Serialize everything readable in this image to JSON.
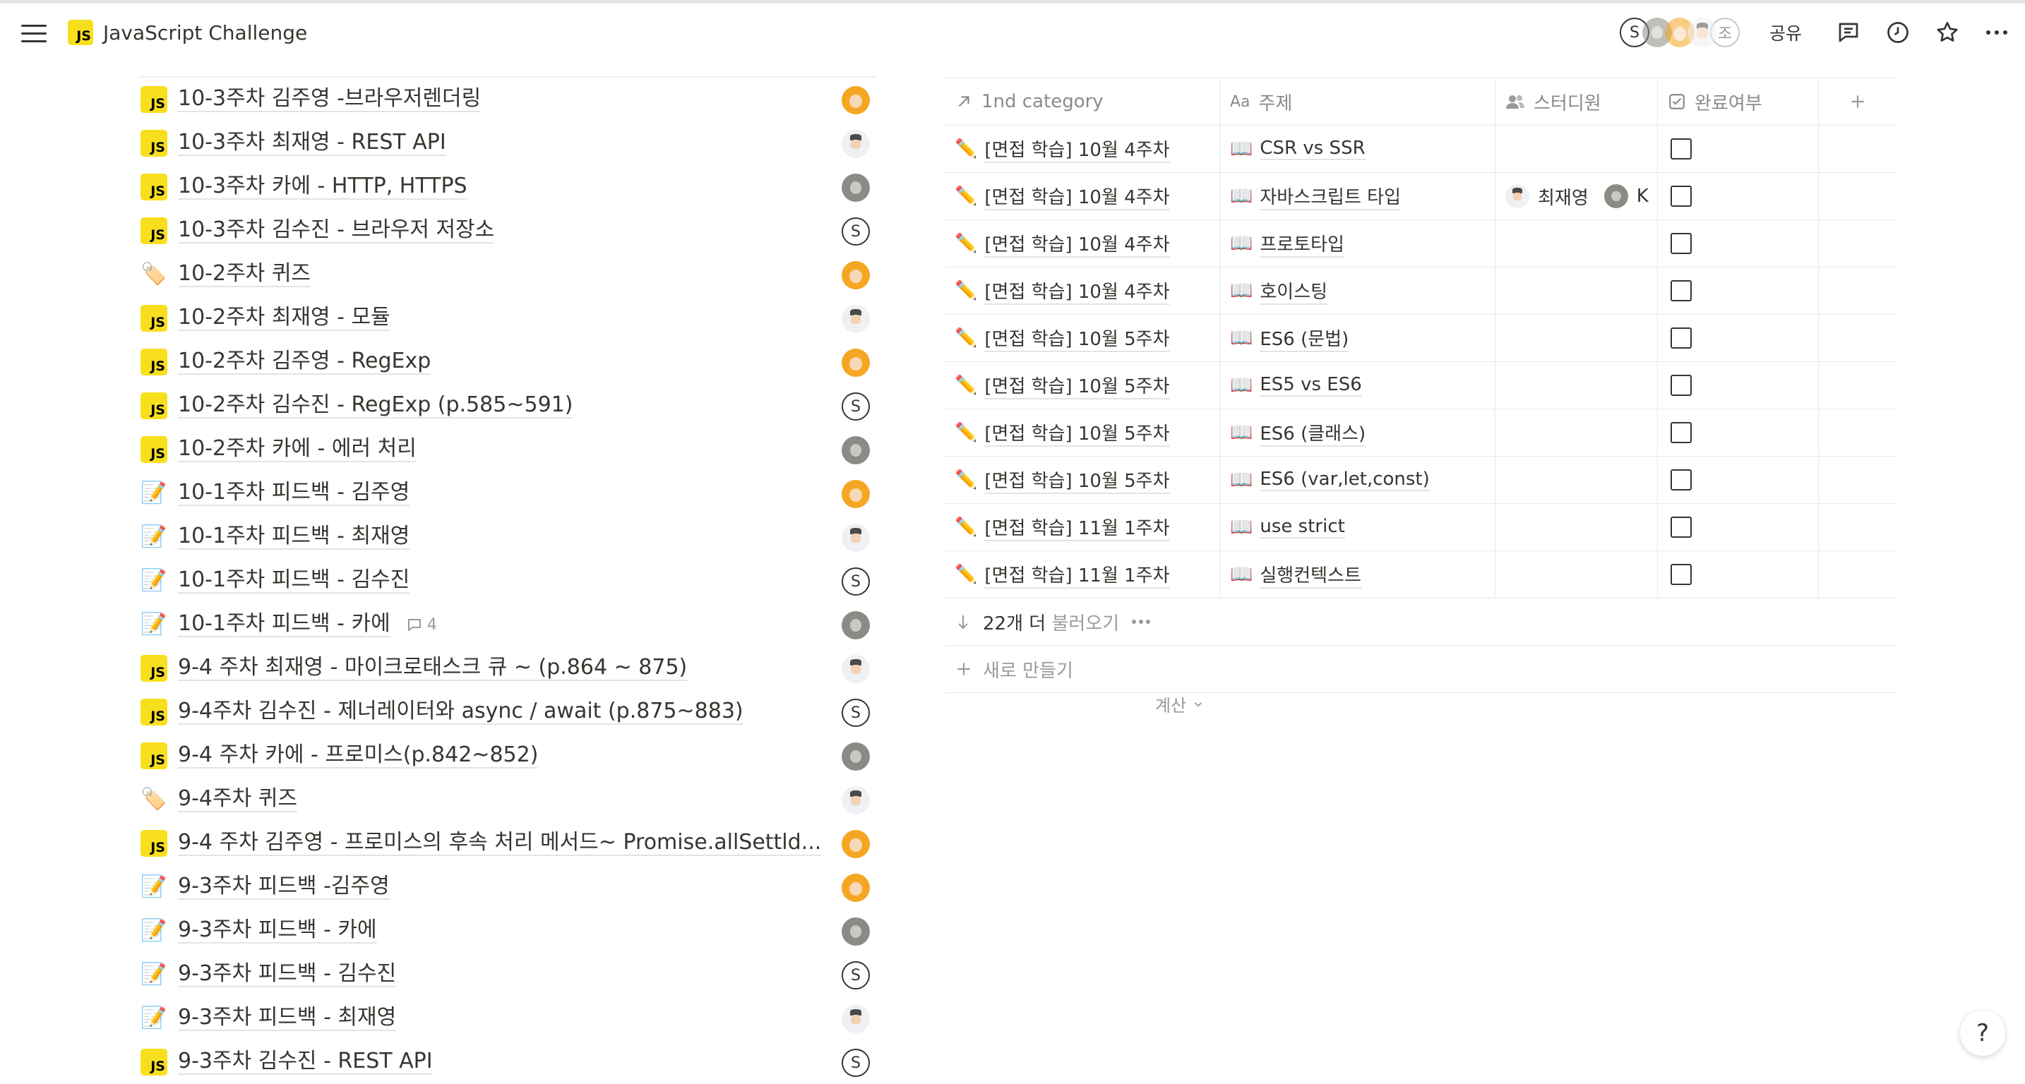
{
  "topbar": {
    "title": "JavaScript Challenge",
    "page_icon": "js-logo-icon",
    "share_label": "공유",
    "avatars": [
      {
        "type": "letter",
        "letter": "S"
      },
      {
        "type": "gray"
      },
      {
        "type": "orange"
      },
      {
        "type": "man"
      },
      {
        "type": "letter-faded",
        "letter": "조"
      }
    ],
    "icons": [
      "comment-icon",
      "history-clock-icon",
      "favorite-star-icon",
      "more-dots-icon"
    ]
  },
  "left_list": [
    {
      "icon": "js",
      "title": "10-3주차 김주영 -브라우저렌더링",
      "avatar": "orange"
    },
    {
      "icon": "js",
      "title": "10-3주차 최재영 - REST API",
      "avatar": "man"
    },
    {
      "icon": "js",
      "title": "10-3주차 카에 - HTTP, HTTPS",
      "avatar": "gray"
    },
    {
      "icon": "js",
      "title": "10-3주차 김수진 - 브라우저 저장소",
      "avatar": "s"
    },
    {
      "icon": "tag",
      "title": "10-2주차 퀴즈",
      "avatar": "orange"
    },
    {
      "icon": "js",
      "title": "10-2주차 최재영 - 모듈",
      "avatar": "man"
    },
    {
      "icon": "js",
      "title": "10-2주차 김주영 - RegExp",
      "avatar": "orange"
    },
    {
      "icon": "js",
      "title": "10-2주차 김수진 - RegExp (p.585~591)",
      "avatar": "s"
    },
    {
      "icon": "js",
      "title": "10-2주차 카에 - 에러 처리",
      "avatar": "gray"
    },
    {
      "icon": "memo",
      "title": "10-1주차 피드백 - 김주영",
      "avatar": "orange"
    },
    {
      "icon": "memo",
      "title": "10-1주차 피드백 - 최재영",
      "avatar": "man"
    },
    {
      "icon": "memo",
      "title": "10-1주차 피드백 - 김수진",
      "avatar": "s"
    },
    {
      "icon": "memo",
      "title": "10-1주차 피드백 - 카에",
      "avatar": "gray",
      "comments": "4"
    },
    {
      "icon": "js",
      "title": "9-4 주차 최재영 - 마이크로태스크 큐 ~ (p.864 ~ 875)",
      "avatar": "man"
    },
    {
      "icon": "js",
      "title": "9-4주차 김수진 - 제너레이터와 async / await (p.875~883)",
      "avatar": "s"
    },
    {
      "icon": "js",
      "title": "9-4 주차 카에 - 프로미스(p.842~852)",
      "avatar": "gray"
    },
    {
      "icon": "tag",
      "title": "9-4주차 퀴즈",
      "avatar": "man"
    },
    {
      "icon": "js",
      "title": "9-4 주차 김주영 - 프로미스의 후속 처리 메서드~ Promise.allSettld...",
      "avatar": "orange"
    },
    {
      "icon": "memo",
      "title": "9-3주차 피드백 -김주영",
      "avatar": "orange"
    },
    {
      "icon": "memo",
      "title": "9-3주차 피드백 - 카에",
      "avatar": "gray"
    },
    {
      "icon": "memo",
      "title": "9-3주차 피드백 - 김수진",
      "avatar": "s"
    },
    {
      "icon": "memo",
      "title": "9-3주차 피드백 - 최재영",
      "avatar": "man"
    },
    {
      "icon": "js",
      "title": "9-3주차 김수진 - REST API",
      "avatar": "s"
    }
  ],
  "table": {
    "headers": [
      {
        "label": "1nd category",
        "icon": "arrow-up-right-icon"
      },
      {
        "label": "주제",
        "icon": "text-aa-icon"
      },
      {
        "label": "스터디원",
        "icon": "people-icon"
      },
      {
        "label": "완료여부",
        "icon": "checkbox-icon"
      }
    ],
    "add_column_icon": "plus-icon",
    "rows": [
      {
        "category": "[면접 학습] 10월 4주차",
        "topic": "CSR vs SSR",
        "members": [],
        "done": false
      },
      {
        "category": "[면접 학습] 10월 4주차",
        "topic": "자바스크립트 타입",
        "members": [
          {
            "name": "최재영",
            "avatar": "man"
          },
          {
            "name": "K",
            "avatar": "gray"
          }
        ],
        "done": false
      },
      {
        "category": "[면접 학습] 10월 4주차",
        "topic": "프로토타입",
        "members": [],
        "done": false
      },
      {
        "category": "[면접 학습] 10월 4주차",
        "topic": "호이스팅",
        "members": [],
        "done": false
      },
      {
        "category": "[면접 학습] 10월 5주차",
        "topic": "ES6 (문법)",
        "members": [],
        "done": false
      },
      {
        "category": "[면접 학습] 10월 5주차",
        "topic": "ES5 vs ES6",
        "members": [],
        "done": false
      },
      {
        "category": "[면접 학습] 10월 5주차",
        "topic": "ES6 (클래스)",
        "members": [],
        "done": false
      },
      {
        "category": "[면접 학습] 10월 5주차",
        "topic": "ES6 (var,let,const)",
        "members": [],
        "done": false
      },
      {
        "category": "[면접 학습] 11월 1주차",
        "topic": "use strict",
        "members": [],
        "done": false
      },
      {
        "category": "[면접 학습] 11월 1주차",
        "topic": "실행컨텍스트",
        "members": [],
        "done": false
      }
    ],
    "load_more_count": "22개 더",
    "load_more_label": "불러오기",
    "new_row_label": "새로 만들기",
    "calc_label": "계산"
  },
  "help_label": "?"
}
